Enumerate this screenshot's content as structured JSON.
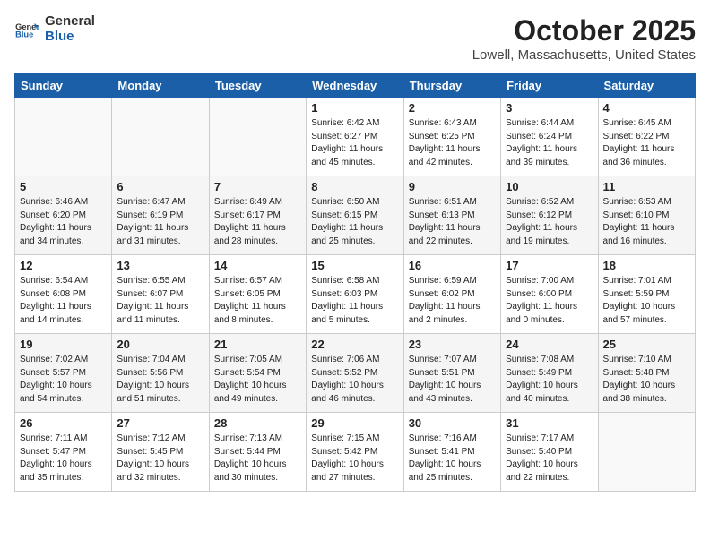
{
  "header": {
    "logo_general": "General",
    "logo_blue": "Blue",
    "month": "October 2025",
    "location": "Lowell, Massachusetts, United States"
  },
  "days_of_week": [
    "Sunday",
    "Monday",
    "Tuesday",
    "Wednesday",
    "Thursday",
    "Friday",
    "Saturday"
  ],
  "weeks": [
    [
      {
        "day": "",
        "info": ""
      },
      {
        "day": "",
        "info": ""
      },
      {
        "day": "",
        "info": ""
      },
      {
        "day": "1",
        "info": "Sunrise: 6:42 AM\nSunset: 6:27 PM\nDaylight: 11 hours\nand 45 minutes."
      },
      {
        "day": "2",
        "info": "Sunrise: 6:43 AM\nSunset: 6:25 PM\nDaylight: 11 hours\nand 42 minutes."
      },
      {
        "day": "3",
        "info": "Sunrise: 6:44 AM\nSunset: 6:24 PM\nDaylight: 11 hours\nand 39 minutes."
      },
      {
        "day": "4",
        "info": "Sunrise: 6:45 AM\nSunset: 6:22 PM\nDaylight: 11 hours\nand 36 minutes."
      }
    ],
    [
      {
        "day": "5",
        "info": "Sunrise: 6:46 AM\nSunset: 6:20 PM\nDaylight: 11 hours\nand 34 minutes."
      },
      {
        "day": "6",
        "info": "Sunrise: 6:47 AM\nSunset: 6:19 PM\nDaylight: 11 hours\nand 31 minutes."
      },
      {
        "day": "7",
        "info": "Sunrise: 6:49 AM\nSunset: 6:17 PM\nDaylight: 11 hours\nand 28 minutes."
      },
      {
        "day": "8",
        "info": "Sunrise: 6:50 AM\nSunset: 6:15 PM\nDaylight: 11 hours\nand 25 minutes."
      },
      {
        "day": "9",
        "info": "Sunrise: 6:51 AM\nSunset: 6:13 PM\nDaylight: 11 hours\nand 22 minutes."
      },
      {
        "day": "10",
        "info": "Sunrise: 6:52 AM\nSunset: 6:12 PM\nDaylight: 11 hours\nand 19 minutes."
      },
      {
        "day": "11",
        "info": "Sunrise: 6:53 AM\nSunset: 6:10 PM\nDaylight: 11 hours\nand 16 minutes."
      }
    ],
    [
      {
        "day": "12",
        "info": "Sunrise: 6:54 AM\nSunset: 6:08 PM\nDaylight: 11 hours\nand 14 minutes."
      },
      {
        "day": "13",
        "info": "Sunrise: 6:55 AM\nSunset: 6:07 PM\nDaylight: 11 hours\nand 11 minutes."
      },
      {
        "day": "14",
        "info": "Sunrise: 6:57 AM\nSunset: 6:05 PM\nDaylight: 11 hours\nand 8 minutes."
      },
      {
        "day": "15",
        "info": "Sunrise: 6:58 AM\nSunset: 6:03 PM\nDaylight: 11 hours\nand 5 minutes."
      },
      {
        "day": "16",
        "info": "Sunrise: 6:59 AM\nSunset: 6:02 PM\nDaylight: 11 hours\nand 2 minutes."
      },
      {
        "day": "17",
        "info": "Sunrise: 7:00 AM\nSunset: 6:00 PM\nDaylight: 11 hours\nand 0 minutes."
      },
      {
        "day": "18",
        "info": "Sunrise: 7:01 AM\nSunset: 5:59 PM\nDaylight: 10 hours\nand 57 minutes."
      }
    ],
    [
      {
        "day": "19",
        "info": "Sunrise: 7:02 AM\nSunset: 5:57 PM\nDaylight: 10 hours\nand 54 minutes."
      },
      {
        "day": "20",
        "info": "Sunrise: 7:04 AM\nSunset: 5:56 PM\nDaylight: 10 hours\nand 51 minutes."
      },
      {
        "day": "21",
        "info": "Sunrise: 7:05 AM\nSunset: 5:54 PM\nDaylight: 10 hours\nand 49 minutes."
      },
      {
        "day": "22",
        "info": "Sunrise: 7:06 AM\nSunset: 5:52 PM\nDaylight: 10 hours\nand 46 minutes."
      },
      {
        "day": "23",
        "info": "Sunrise: 7:07 AM\nSunset: 5:51 PM\nDaylight: 10 hours\nand 43 minutes."
      },
      {
        "day": "24",
        "info": "Sunrise: 7:08 AM\nSunset: 5:49 PM\nDaylight: 10 hours\nand 40 minutes."
      },
      {
        "day": "25",
        "info": "Sunrise: 7:10 AM\nSunset: 5:48 PM\nDaylight: 10 hours\nand 38 minutes."
      }
    ],
    [
      {
        "day": "26",
        "info": "Sunrise: 7:11 AM\nSunset: 5:47 PM\nDaylight: 10 hours\nand 35 minutes."
      },
      {
        "day": "27",
        "info": "Sunrise: 7:12 AM\nSunset: 5:45 PM\nDaylight: 10 hours\nand 32 minutes."
      },
      {
        "day": "28",
        "info": "Sunrise: 7:13 AM\nSunset: 5:44 PM\nDaylight: 10 hours\nand 30 minutes."
      },
      {
        "day": "29",
        "info": "Sunrise: 7:15 AM\nSunset: 5:42 PM\nDaylight: 10 hours\nand 27 minutes."
      },
      {
        "day": "30",
        "info": "Sunrise: 7:16 AM\nSunset: 5:41 PM\nDaylight: 10 hours\nand 25 minutes."
      },
      {
        "day": "31",
        "info": "Sunrise: 7:17 AM\nSunset: 5:40 PM\nDaylight: 10 hours\nand 22 minutes."
      },
      {
        "day": "",
        "info": ""
      }
    ]
  ]
}
